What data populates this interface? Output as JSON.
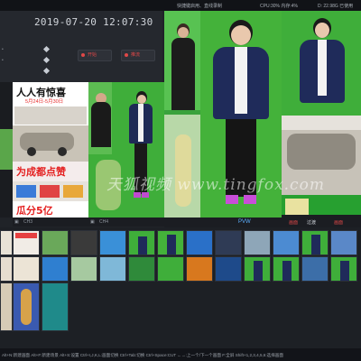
{
  "topbar": {
    "title": "快捷键启用、直线录制",
    "cpu": "CPU:30% 内存:4%",
    "disk": "D: 22.98G 已使用"
  },
  "control": {
    "datetime": "2019-07-20 12:07:30",
    "record_button": "开始",
    "stream_button": "推流"
  },
  "ad": {
    "headline": "人人有惊喜",
    "dates": "5月24日-5月30日",
    "promo": "为成都点赞",
    "bottom": "瓜分5亿"
  },
  "source_bars": {
    "ch3": "CH3",
    "ch4": "CH4"
  },
  "preview": {
    "label": "PVW"
  },
  "transition": {
    "label1": "画面",
    "label2": "过渡",
    "label3": "画面"
  },
  "watermark": "天狐视频 www.tingfox.com",
  "bottombar": {
    "hint": "Alt+N:新建画面  Alt+F:新建场景  Alt+S:设置  Ctrl+I,J,K,L:画面切换  Ctrl+Tab:切换  Ctrl+Space:CUT  ←→:上一个/下一个画面  F:全屏  Shift+1,2,3,4,5,6:选择画面"
  },
  "colors": {
    "green_screen": "#3aa23c",
    "accent_red": "#e04848",
    "accent_blue": "#5cb0ff"
  }
}
